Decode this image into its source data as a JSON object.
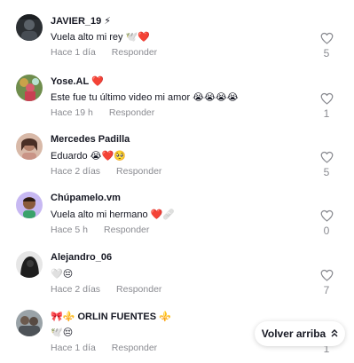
{
  "comments": [
    {
      "username": "JAVIER_19",
      "badge": "⚡",
      "text": "Vuela alto mi rey 🕊️❤️",
      "time": "Hace 1 día",
      "reply": "Responder",
      "likes": "5",
      "avatar_icon": "avatar-dark"
    },
    {
      "username": "Yose.AL",
      "badge": "❤️",
      "text": "Este fue tu último video mi amor 😭😭😭😭",
      "time": "Hace 19 h",
      "reply": "Responder",
      "likes": "1",
      "avatar_icon": "avatar-flowers"
    },
    {
      "username": "Mercedes Padilla",
      "badge": "",
      "text": "Eduardo 😭❤️🥺",
      "time": "Hace 2 días",
      "reply": "Responder",
      "likes": "5",
      "avatar_icon": "avatar-woman"
    },
    {
      "username": "Chúpamelo.vm",
      "badge": "",
      "text": "Vuela alto mi hermano ❤️🩹",
      "time": "Hace 5 h",
      "reply": "Responder",
      "likes": "0",
      "avatar_icon": "avatar-cartoon"
    },
    {
      "username": "Alejandro_06",
      "badge": "",
      "text": "🤍😔",
      "time": "Hace 2 días",
      "reply": "Responder",
      "likes": "7",
      "avatar_icon": "avatar-dark-hood"
    },
    {
      "username": "🎀⚜️ ORLIN FUENTES",
      "badge": "⚜️",
      "text": "🕊️😔",
      "time": "Hace 1 día",
      "reply": "Responder",
      "likes": "1",
      "avatar_icon": "avatar-group"
    }
  ],
  "back_to_top": {
    "label": "Volver arriba",
    "icon": "chevron-double-up-icon"
  },
  "colors": {
    "text": "#161823",
    "muted": "#8a8b91",
    "background": "#ffffff"
  }
}
